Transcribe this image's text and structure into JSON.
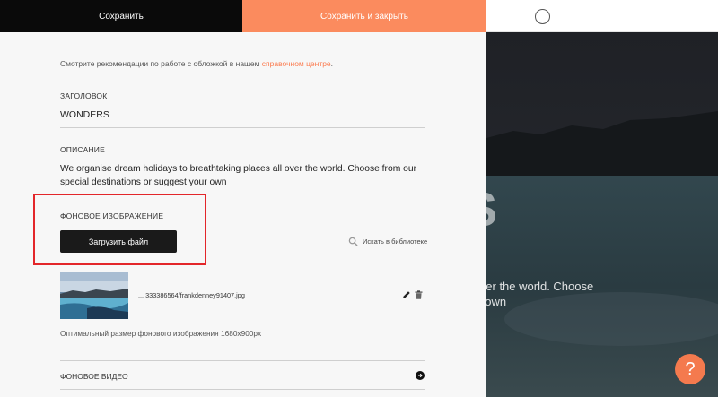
{
  "toolbar": {
    "save_label": "Сохранить",
    "save_close_label": "Сохранить и закрыть"
  },
  "hint": {
    "text": "Смотрите рекомендации по работе с обложкой в нашем ",
    "link": "справочном центре",
    "suffix": "."
  },
  "title_field": {
    "label": "ЗАГОЛОВОК",
    "value": "WONDERS"
  },
  "description_field": {
    "label": "ОПИСАНИЕ",
    "value": "We organise dream holidays to breathtaking places all over the world. Choose from our special destinations or suggest your own"
  },
  "background_image": {
    "label": "ФОНОВОЕ ИЗОБРАЖЕНИЕ",
    "upload_label": "Загрузить файл",
    "library_search_label": "Искать в библиотеке",
    "filename": "... 333386564/frankdenney91407.jpg",
    "size_note": "Оптимальный размер фонового изображения 1680x900px"
  },
  "background_video": {
    "label": "ФОНОВОЕ ВИДЕО"
  },
  "preview": {
    "title": "WONDERS",
    "desc_line1": "We organise dream holidays to breathtaking places all over the world. Choose",
    "desc_line2": "from our special destinations or suggest your own"
  },
  "help": {
    "label": "?"
  },
  "colors": {
    "accent": "#fb8b5e",
    "dark": "#0a0a0a",
    "link": "#fb7b4f",
    "highlight_box": "#e3262a"
  }
}
